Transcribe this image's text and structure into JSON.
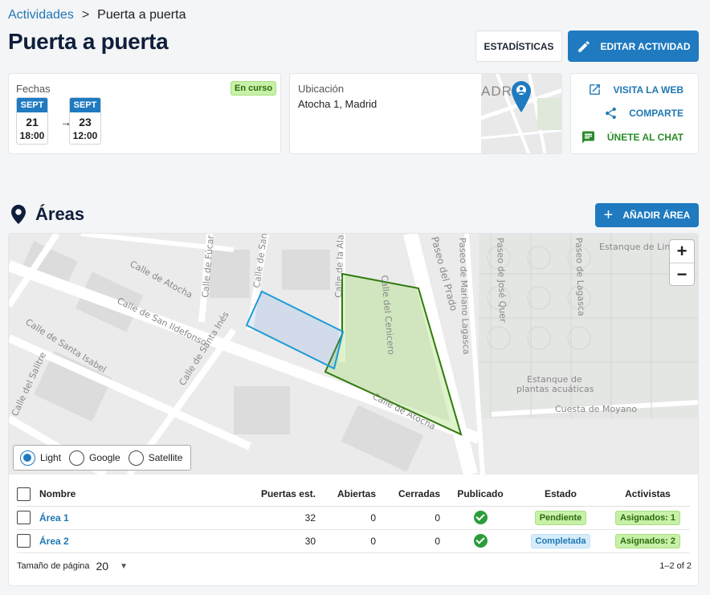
{
  "breadcrumb": {
    "parent": "Actividades",
    "separator": ">",
    "current": "Puerta a puerta"
  },
  "page": {
    "title": "Puerta a puerta"
  },
  "header_buttons": {
    "stats": "ESTADÍSTICAS",
    "edit": "EDITAR ACTIVIDAD"
  },
  "dates_card": {
    "label": "Fechas",
    "status": "En curso",
    "start": {
      "month": "SEPT",
      "day": "21",
      "time": "18:00"
    },
    "end": {
      "month": "SEPT",
      "day": "23",
      "time": "12:00"
    }
  },
  "location_card": {
    "label": "Ubicación",
    "address": "Atocha 1, Madrid",
    "map_text": "ADR"
  },
  "links": {
    "web": {
      "label": "VISITA LA WEB",
      "icon": "external-link-icon"
    },
    "share": {
      "label": "COMPARTE",
      "icon": "share-icon"
    },
    "chat": {
      "label": "ÚNETE AL CHAT",
      "icon": "chat-icon"
    }
  },
  "areas": {
    "title": "Áreas",
    "add_button": "AÑADIR ÁREA"
  },
  "map": {
    "streets": {
      "calle_atocha_1": "Calle de Atocha",
      "calle_atocha_2": "Calle de Atocha",
      "san_ildefonso": "Calle de San Ildefonso",
      "santa_isabel": "Calle de Santa Isabel",
      "santa_ines": "Calle de Santa Inés",
      "salitre": "Calle del Salitre",
      "fucar": "Calle de Fúcar",
      "san_pedro": "Calle de San Pedro",
      "alameda": "Calle de la Alameda",
      "cenicero": "Calle del Cenicero",
      "paseo_prado": "Paseo del Prado",
      "mariano_lagasca": "Paseo de Mariano Lagasca",
      "jose_quer": "Paseo de José Quer",
      "lagasca": "Paseo de Lagasca",
      "estanque_linneo": "Estanque de Linneo",
      "estanque_plantas_1": "Estanque de",
      "estanque_plantas_2": "plantas acuáticas",
      "cuesta_moyano": "Cuesta de Moyano"
    },
    "zoom_in": "+",
    "zoom_out": "−",
    "layers": [
      {
        "label": "Light",
        "selected": true
      },
      {
        "label": "Google",
        "selected": false
      },
      {
        "label": "Satellite",
        "selected": false
      }
    ],
    "colors": {
      "area_blue": "#1e9bd7",
      "area_green": "#2f7a0b"
    }
  },
  "table": {
    "headers": {
      "name": "Nombre",
      "doors": "Puertas est.",
      "open": "Abiertas",
      "closed": "Cerradas",
      "published": "Publicado",
      "state": "Estado",
      "activists": "Activistas"
    },
    "rows": [
      {
        "name": "Área 1",
        "doors": "32",
        "open": "0",
        "closed": "0",
        "published": true,
        "state": "Pendiente",
        "activists": "Asignados: 1"
      },
      {
        "name": "Área 2",
        "doors": "30",
        "open": "0",
        "closed": "0",
        "published": true,
        "state": "Completada",
        "activists": "Asignados: 2"
      }
    ]
  },
  "pagination": {
    "page_size_label": "Tamaño de página",
    "page_size": "20",
    "range": "1–2 of 2"
  }
}
